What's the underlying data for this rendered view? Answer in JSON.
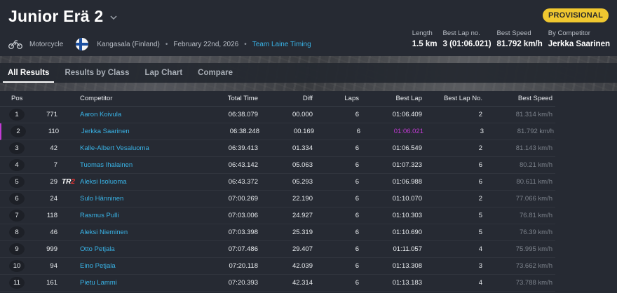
{
  "race": {
    "title": "Junior Erä 2",
    "status_badge": "PROVISIONAL",
    "status_color": "#f0c830",
    "sport": "Motorcycle",
    "location": "Kangasala (Finland)",
    "date": "February 22nd, 2026",
    "organizer": "Team Laine Timing",
    "separator": "•"
  },
  "stats": {
    "length_label": "Length",
    "length_value": "1.5 km",
    "best_lap_no_label": "Best Lap no.",
    "best_lap_no_value": "3 (01:06.021)",
    "best_speed_label": "Best Speed",
    "best_speed_value": "81.792 km/h",
    "by_competitor_label": "By Competitor",
    "by_competitor_value": "Jerkka Saarinen"
  },
  "tabs": [
    {
      "label": "All Results",
      "active": true
    },
    {
      "label": "Results by Class",
      "active": false
    },
    {
      "label": "Lap Chart",
      "active": false
    },
    {
      "label": "Compare",
      "active": false
    }
  ],
  "table": {
    "headers": {
      "pos": "Pos",
      "competitor": "Competitor",
      "total_time": "Total Time",
      "diff": "Diff",
      "laps": "Laps",
      "best_lap": "Best Lap",
      "best_lap_no": "Best Lap No.",
      "best_speed": "Best Speed"
    },
    "rows": [
      {
        "pos": "1",
        "num": "771",
        "logo": "",
        "name": "Aaron Koivula",
        "total": "06:38.079",
        "diff": "00.000",
        "laps": "6",
        "best": "01:06.409",
        "best_no": "2",
        "speed": "81.314 km/h"
      },
      {
        "pos": "2",
        "num": "110",
        "logo": "",
        "name": "Jerkka Saarinen",
        "total": "06:38.248",
        "diff": "00.169",
        "laps": "6",
        "best": "01:06.021",
        "best_no": "3",
        "speed": "81.792 km/h"
      },
      {
        "pos": "3",
        "num": "42",
        "logo": "",
        "name": "Kalle-Albert Vesaluoma",
        "total": "06:39.413",
        "diff": "01.334",
        "laps": "6",
        "best": "01:06.549",
        "best_no": "2",
        "speed": "81.143 km/h"
      },
      {
        "pos": "4",
        "num": "7",
        "logo": "",
        "name": "Tuomas Ihalainen",
        "total": "06:43.142",
        "diff": "05.063",
        "laps": "6",
        "best": "01:07.323",
        "best_no": "6",
        "speed": "80.21 km/h"
      },
      {
        "pos": "5",
        "num": "29",
        "logo": "TR2",
        "name": "Aleksi Isoluoma",
        "total": "06:43.372",
        "diff": "05.293",
        "laps": "6",
        "best": "01:06.988",
        "best_no": "6",
        "speed": "80.611 km/h"
      },
      {
        "pos": "6",
        "num": "24",
        "logo": "",
        "name": "Sulo Hänninen",
        "total": "07:00.269",
        "diff": "22.190",
        "laps": "6",
        "best": "01:10.070",
        "best_no": "2",
        "speed": "77.066 km/h"
      },
      {
        "pos": "7",
        "num": "118",
        "logo": "",
        "name": "Rasmus Pulli",
        "total": "07:03.006",
        "diff": "24.927",
        "laps": "6",
        "best": "01:10.303",
        "best_no": "5",
        "speed": "76.81 km/h"
      },
      {
        "pos": "8",
        "num": "46",
        "logo": "",
        "name": "Aleksi Nieminen",
        "total": "07:03.398",
        "diff": "25.319",
        "laps": "6",
        "best": "01:10.690",
        "best_no": "5",
        "speed": "76.39 km/h"
      },
      {
        "pos": "9",
        "num": "999",
        "logo": "",
        "name": "Otto Petjala",
        "total": "07:07.486",
        "diff": "29.407",
        "laps": "6",
        "best": "01:11.057",
        "best_no": "4",
        "speed": "75.995 km/h"
      },
      {
        "pos": "10",
        "num": "94",
        "logo": "",
        "name": "Eino Petjala",
        "total": "07:20.118",
        "diff": "42.039",
        "laps": "6",
        "best": "01:13.308",
        "best_no": "3",
        "speed": "73.662 km/h"
      },
      {
        "pos": "11",
        "num": "161",
        "logo": "",
        "name": "Pietu Lammi",
        "total": "07:20.393",
        "diff": "42.314",
        "laps": "6",
        "best": "01:13.183",
        "best_no": "4",
        "speed": "73.788 km/h"
      }
    ]
  },
  "icons": {
    "sport_icon": "motorcycle-icon",
    "flag_icon": "finland-flag-icon",
    "dropdown_icon": "chevron-down-icon"
  },
  "colors": {
    "link": "#39b3e6",
    "best_lap_highlight": "#c23bd4"
  }
}
